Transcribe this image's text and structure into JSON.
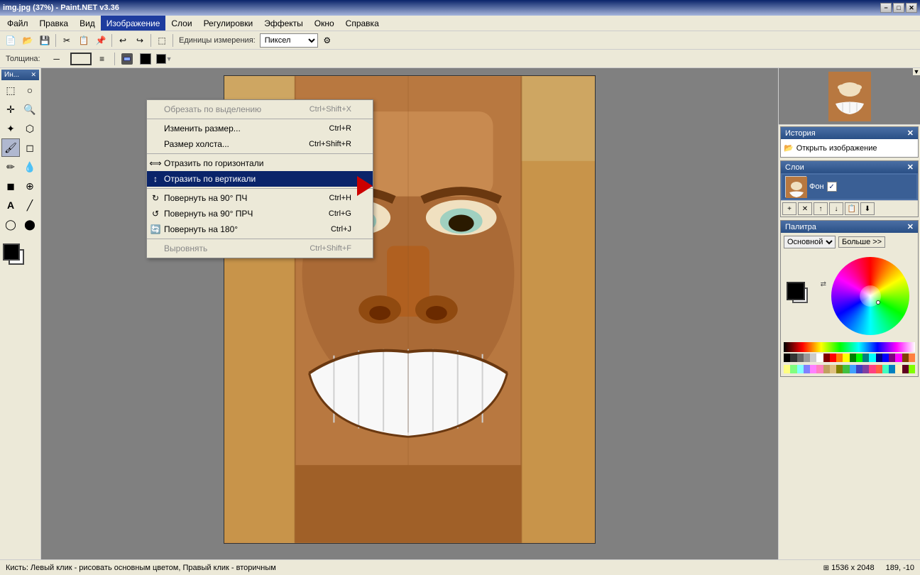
{
  "titleBar": {
    "title": "img.jpg (37%) - Paint.NET v3.36",
    "minimizeBtn": "−",
    "maximizeBtn": "□",
    "closeBtn": "✕"
  },
  "menuBar": {
    "items": [
      {
        "id": "file",
        "label": "Файл"
      },
      {
        "id": "edit",
        "label": "Правка"
      },
      {
        "id": "view",
        "label": "Вид"
      },
      {
        "id": "image",
        "label": "Изображение",
        "active": true
      },
      {
        "id": "layers",
        "label": "Слои"
      },
      {
        "id": "adjustments",
        "label": "Регулировки"
      },
      {
        "id": "effects",
        "label": "Эффекты"
      },
      {
        "id": "window",
        "label": "Окно"
      },
      {
        "id": "help",
        "label": "Справка"
      }
    ]
  },
  "toolbar": {
    "measurementLabel": "Единицы измерения:",
    "measurementValue": "Пиксел",
    "thicknessLabel": "Толщина:"
  },
  "imageMenu": {
    "items": [
      {
        "id": "crop",
        "label": "Обрезать по выделению",
        "shortcut": "Ctrl+Shift+X",
        "disabled": false
      },
      {
        "id": "separator1",
        "type": "separator"
      },
      {
        "id": "resize",
        "label": "Изменить размер...",
        "shortcut": "Ctrl+R",
        "disabled": false
      },
      {
        "id": "canvas-size",
        "label": "Размер холста...",
        "shortcut": "Ctrl+Shift+R",
        "disabled": false
      },
      {
        "id": "separator2",
        "type": "separator"
      },
      {
        "id": "flip-h",
        "label": "Отразить по горизонтали",
        "shortcut": "",
        "disabled": false
      },
      {
        "id": "flip-v",
        "label": "Отразить по вертикали",
        "shortcut": "",
        "highlighted": true,
        "disabled": false
      },
      {
        "id": "separator3",
        "type": "separator"
      },
      {
        "id": "rotate-cw",
        "label": "Повернуть на 90° ПЧ",
        "shortcut": "Ctrl+H",
        "disabled": false
      },
      {
        "id": "rotate-ccw",
        "label": "Повернуть на 90° ПРЧ",
        "shortcut": "Ctrl+G",
        "disabled": false
      },
      {
        "id": "rotate-180",
        "label": "Повернуть на 180°",
        "shortcut": "Ctrl+J",
        "disabled": false
      },
      {
        "id": "separator4",
        "type": "separator"
      },
      {
        "id": "align",
        "label": "Выровнять",
        "shortcut": "Ctrl+Shift+F",
        "disabled": true
      }
    ]
  },
  "historyPanel": {
    "title": "История",
    "items": [
      {
        "label": "Открыть изображение",
        "icon": "📂"
      }
    ]
  },
  "layersPanel": {
    "title": "Слои",
    "layers": [
      {
        "name": "Фон",
        "visible": true
      }
    ],
    "buttons": [
      "+",
      "✕",
      "↑",
      "↓",
      "📋",
      "🔀"
    ]
  },
  "palettePanel": {
    "title": "Палитра",
    "selectOptions": [
      "Основной"
    ],
    "moreBtn": "Больше >>",
    "colorSwatches": [
      "#000000",
      "#808080",
      "#c0c0c0",
      "#ffffff",
      "#800000",
      "#ff0000",
      "#ff8000",
      "#ffff00",
      "#008000",
      "#00ff00",
      "#008080",
      "#00ffff",
      "#000080",
      "#0000ff",
      "#800080",
      "#ff00ff",
      "#804000",
      "#ff8040",
      "#ffff80",
      "#80ff80",
      "#80ffff",
      "#8080ff",
      "#ff80ff",
      "#ff80c0"
    ]
  },
  "statusBar": {
    "text": "Кисть: Левый клик - рисовать основным цветом, Правый клик - вторичным",
    "dimensions": "1536 x 2048",
    "coordinates": "189, -10"
  },
  "toolbox": {
    "title": "Ин...",
    "tools": [
      {
        "id": "select-rect",
        "icon": "⬚",
        "label": "Rectangle Select"
      },
      {
        "id": "select-lasso",
        "icon": "🔘",
        "label": "Lasso Select"
      },
      {
        "id": "move",
        "icon": "✛",
        "label": "Move"
      },
      {
        "id": "zoom",
        "icon": "🔍",
        "label": "Zoom"
      },
      {
        "id": "magic-wand",
        "icon": "✦",
        "label": "Magic Wand"
      },
      {
        "id": "paint-bucket",
        "icon": "🪣",
        "label": "Paint Bucket"
      },
      {
        "id": "brush",
        "icon": "🖌",
        "label": "Brush"
      },
      {
        "id": "eraser",
        "icon": "◻",
        "label": "Eraser"
      },
      {
        "id": "pencil",
        "icon": "✏",
        "label": "Pencil"
      },
      {
        "id": "color-picker",
        "icon": "💧",
        "label": "Color Picker"
      },
      {
        "id": "gradient",
        "icon": "◼",
        "label": "Gradient"
      },
      {
        "id": "text",
        "icon": "A",
        "label": "Text"
      },
      {
        "id": "line",
        "icon": "╱",
        "label": "Line"
      },
      {
        "id": "shapes",
        "icon": "◯",
        "label": "Shapes"
      },
      {
        "id": "clone-stamp",
        "icon": "⊕",
        "label": "Clone Stamp"
      },
      {
        "id": "recolor",
        "icon": "🎨",
        "label": "Recolor"
      }
    ]
  }
}
